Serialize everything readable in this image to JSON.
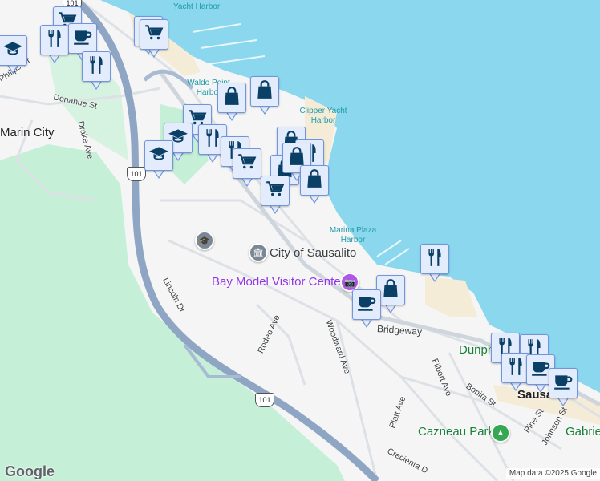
{
  "map": {
    "colors": {
      "water": "#8ad7ee",
      "land": "#f5f5f5",
      "park": "#c5efd6",
      "highway": "#8ea5c4",
      "marker_bg": "#e3ecfc",
      "marker_border": "#7095dc",
      "marker_icon": "#0b4066"
    },
    "water_labels": {
      "yacht_harbor": "Yacht Harbor",
      "waldo_point": "Waldo Point Harbor",
      "clipper": "Clipper Yacht Harbor",
      "marina_plaza": "Marina Plaza Harbor"
    },
    "places": {
      "marin_city": "Marin City",
      "city_of_sausalito": "City of Sausalito",
      "bay_model": "Bay Model Visitor Center",
      "cazneau_park": "Cazneau Park",
      "dunphy": "Dunph",
      "sausalito": "Sausa",
      "gabrielson": "Gabrie"
    },
    "streets": {
      "donahue": "Donahue St",
      "drake": "Drake Ave",
      "philips": "Philips Dr",
      "lincoln": "Lincoln Dr",
      "rodeo": "Rodeo Ave",
      "woodward": "Woodward Ave",
      "bridgeway": "Bridgeway",
      "filbert": "Filbert Ave",
      "bonita": "Bonita St",
      "platt": "Platt Ave",
      "pine": "Pine St",
      "johnson": "Johnson St",
      "crecienta": "Crecienta D"
    },
    "highway_shield": "101",
    "logo": "Google",
    "attribution": "Map data ©2025 Google"
  },
  "markers": [
    {
      "type": "grocery-cart"
    },
    {
      "type": "restaurant"
    },
    {
      "type": "coffee"
    },
    {
      "type": "restaurant"
    },
    {
      "type": "school"
    },
    {
      "type": "grocery-cart"
    },
    {
      "type": "grocery-cart"
    },
    {
      "type": "shopping-bag"
    },
    {
      "type": "shopping-bag"
    },
    {
      "type": "grocery-cart"
    },
    {
      "type": "school"
    },
    {
      "type": "restaurant"
    },
    {
      "type": "restaurant"
    },
    {
      "type": "grocery-cart"
    },
    {
      "type": "shopping-bag"
    },
    {
      "type": "shopping-bag"
    },
    {
      "type": "restaurant"
    },
    {
      "type": "shopping-bag"
    },
    {
      "type": "shopping-bag"
    },
    {
      "type": "grocery-cart"
    },
    {
      "type": "school"
    },
    {
      "type": "restaurant"
    },
    {
      "type": "shopping-bag"
    },
    {
      "type": "coffee"
    },
    {
      "type": "restaurant"
    },
    {
      "type": "restaurant"
    },
    {
      "type": "restaurant"
    },
    {
      "type": "coffee"
    },
    {
      "type": "coffee"
    }
  ]
}
